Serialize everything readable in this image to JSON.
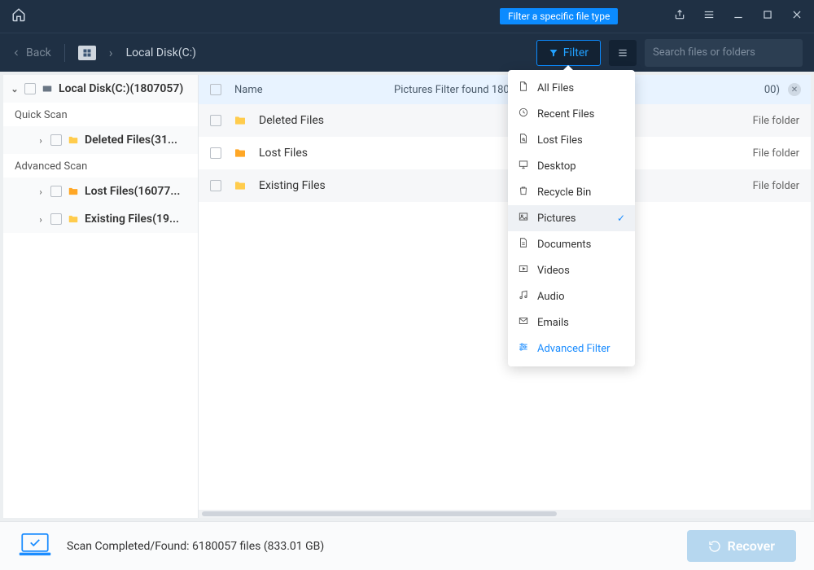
{
  "tooltip": "Filter a specific file type",
  "back_label": "Back",
  "breadcrumb_location": "Local Disk(C:)",
  "filter_button_label": "Filter",
  "search_placeholder": "Search files or folders",
  "sidebar": {
    "root_label": "Local Disk(C:)(1807057)",
    "sections": [
      {
        "title": "Quick Scan",
        "items": [
          {
            "label": "Deleted Files(31..."
          }
        ]
      },
      {
        "title": "Advanced Scan",
        "items": [
          {
            "label": "Lost Files(16077..."
          },
          {
            "label": "Existing Files(19..."
          }
        ]
      }
    ]
  },
  "column_name_header": "Name",
  "filter_strip_message": "Pictures Filter found 1807057 item",
  "filter_strip_tail": "00)",
  "rows": [
    {
      "name": "Deleted Files",
      "type": "File folder",
      "color": "y"
    },
    {
      "name": "Lost Files",
      "type": "File folder",
      "color": "o"
    },
    {
      "name": "Existing Files",
      "type": "File folder",
      "color": "y"
    }
  ],
  "footer_status": "Scan Completed/Found: 6180057 files (833.01 GB)",
  "recover_label": "Recover",
  "filter_options": [
    {
      "label": "All Files",
      "icon": "file"
    },
    {
      "label": "Recent Files",
      "icon": "recent"
    },
    {
      "label": "Lost Files",
      "icon": "lost"
    },
    {
      "label": "Desktop",
      "icon": "desktop"
    },
    {
      "label": "Recycle Bin",
      "icon": "recycle"
    },
    {
      "label": "Pictures",
      "icon": "pictures",
      "selected": true
    },
    {
      "label": "Documents",
      "icon": "documents"
    },
    {
      "label": "Videos",
      "icon": "videos"
    },
    {
      "label": "Audio",
      "icon": "audio"
    },
    {
      "label": "Emails",
      "icon": "emails"
    },
    {
      "label": "Advanced Filter",
      "icon": "sliders",
      "advanced": true
    }
  ]
}
